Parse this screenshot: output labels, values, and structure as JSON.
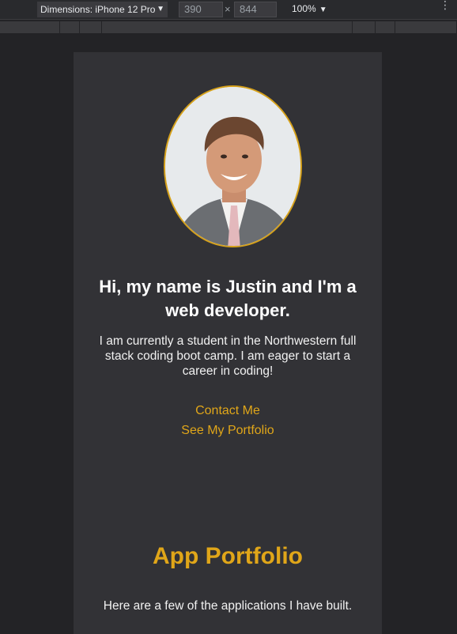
{
  "devtools": {
    "device_label": "Dimensions: iPhone 12 Pro",
    "width_value": "390",
    "height_value": "844",
    "times_symbol": "×",
    "zoom_label": "100%",
    "caret": "▼",
    "more_icon": "⋮"
  },
  "page": {
    "avatar_icon": "profile-photo",
    "intro": {
      "heading": "Hi, my name is Justin and I'm a web developer.",
      "text": "I am currently a student in the Northwestern full stack coding boot camp. I am eager to start a career in coding!"
    },
    "links": {
      "contact": "Contact Me",
      "portfolio": "See My Portfolio"
    },
    "portfolio": {
      "heading": "App Portfolio",
      "text": "Here are a few of the applications I have built."
    }
  },
  "colors": {
    "accent": "#e0a619",
    "background": "#232326",
    "viewport": "#323236"
  }
}
